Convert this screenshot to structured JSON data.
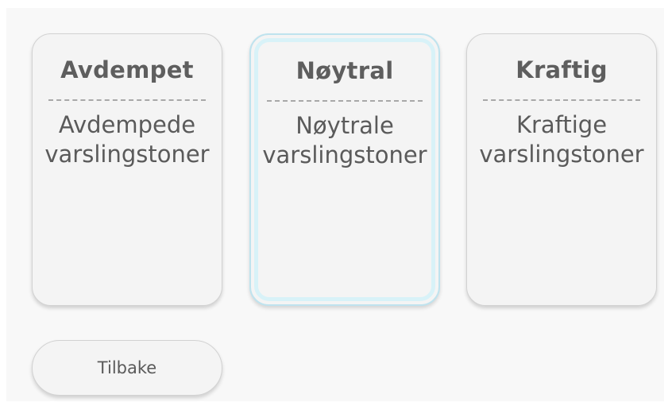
{
  "options": [
    {
      "title": "Avdempet",
      "description": "Avdempede\nvarslingstoner",
      "selected": false
    },
    {
      "title": "Nøytral",
      "description": "Nøytrale\nvarslingstoner",
      "selected": true
    },
    {
      "title": "Kraftig",
      "description": "Kraftige\nvarslingstoner",
      "selected": false
    }
  ],
  "back_button": {
    "label": "Tilbake"
  },
  "colors": {
    "background": "#f8f8f8",
    "card": "#f4f4f4",
    "text": "#5a5a5a",
    "selected_border": "#bfe3ee"
  }
}
